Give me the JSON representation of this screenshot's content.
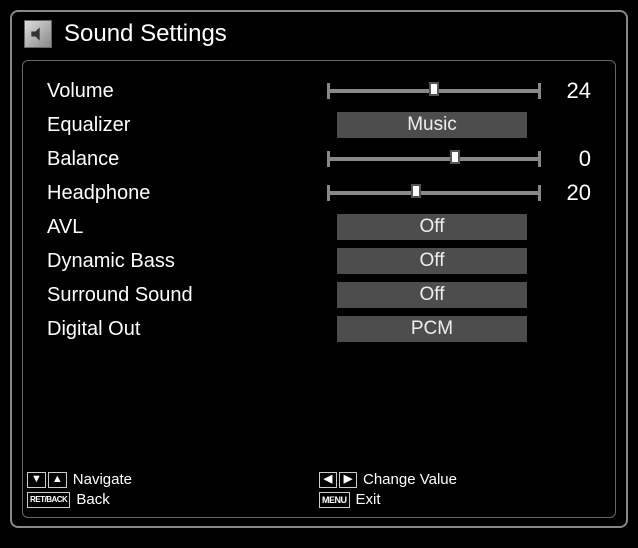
{
  "title": "Sound Settings",
  "settings": {
    "volume": {
      "label": "Volume",
      "value": 24,
      "display": "24",
      "min": 0,
      "max": 48,
      "type": "slider"
    },
    "equalizer": {
      "label": "Equalizer",
      "value": "Music",
      "type": "select"
    },
    "balance": {
      "label": "Balance",
      "value": 0,
      "display": "0",
      "min": -32,
      "max": 32,
      "type": "slider"
    },
    "headphone": {
      "label": "Headphone",
      "value": 20,
      "display": "20",
      "min": 0,
      "max": 48,
      "type": "slider"
    },
    "avl": {
      "label": "AVL",
      "value": "Off",
      "type": "select"
    },
    "dynbass": {
      "label": "Dynamic Bass",
      "value": "Off",
      "type": "select"
    },
    "surround": {
      "label": "Surround Sound",
      "value": "Off",
      "type": "select"
    },
    "digout": {
      "label": "Digital Out",
      "value": "PCM",
      "type": "select"
    }
  },
  "footer": {
    "navigate": "Navigate",
    "back": "Back",
    "change": "Change Value",
    "exit": "Exit",
    "retback_key": "RET/BACK",
    "menu_key": "MENU"
  }
}
